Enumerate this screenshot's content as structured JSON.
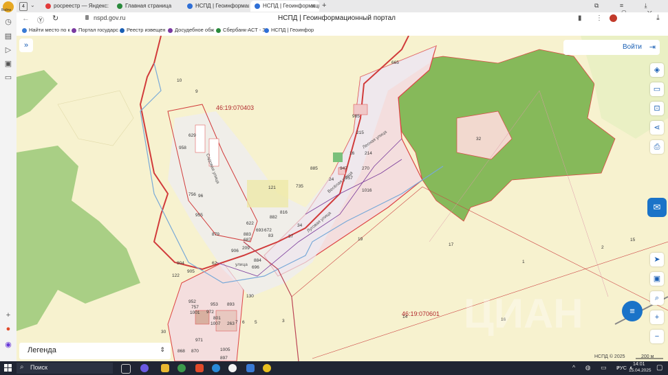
{
  "browser": {
    "user_label": "Войти",
    "tab_count": "4",
    "tabs": [
      {
        "title": "росреестр — Яндекс: нашл",
        "color": "#e23b3b"
      },
      {
        "title": "Главная страница",
        "color": "#2a8a3c"
      },
      {
        "title": "НСПД | Геоинформацион",
        "color": "#2f6fd6"
      },
      {
        "title": "НСПД | Геоинформацио",
        "color": "#2f6fd6"
      }
    ],
    "active_tab": 3,
    "url": "nspd.gov.ru",
    "page_title": "НСПД | Геоинформационный портал",
    "bookmarks": [
      {
        "label": "Найти место по к",
        "color": "#3a7bd5"
      },
      {
        "label": "Портал государс",
        "color": "#7a3aa0"
      },
      {
        "label": "Реестр извещен",
        "color": "#1a5fb4"
      },
      {
        "label": "Досудебное обж",
        "color": "#7a3aa0"
      },
      {
        "label": "Сбербанк-АСТ - З",
        "color": "#2a8a3c"
      },
      {
        "label": "НСПД | Геоинфор",
        "color": "#2f6fd6"
      }
    ]
  },
  "map": {
    "login_label": "Войти",
    "legend_label": "Легенда",
    "quarters": [
      "46:19:070403",
      "46:19:070601"
    ],
    "parcels": [
      "665",
      "10",
      "9",
      "629",
      "958",
      "985",
      "215",
      "214",
      "270",
      "947",
      "957",
      "24",
      "16",
      "885",
      "121",
      "735",
      "1016",
      "816",
      "882",
      "622",
      "883",
      "687",
      "693",
      "672",
      "83",
      "37",
      "34",
      "209",
      "906",
      "884",
      "696",
      "879",
      "756",
      "96",
      "955",
      "62",
      "904",
      "905",
      "122",
      "19",
      "17",
      "1",
      "2",
      "15",
      "16",
      "14",
      "32",
      "130",
      "953",
      "893",
      "952",
      "757",
      "1001",
      "972",
      "801",
      "1007",
      "263",
      "7",
      "6",
      "5",
      "3",
      "30",
      "971",
      "868",
      "870",
      "897",
      "1005"
    ],
    "streets": [
      "Садовая улица",
      "Лесная улица",
      "Весёлая улица",
      "Луговая улица",
      "улица"
    ],
    "scale_label": "200 м",
    "copyright": "НСПД © 2025",
    "watermark": "ЦИАН"
  },
  "taskbar": {
    "search_label": "Поиск",
    "lang": "РУС",
    "time": "14:01",
    "date": "15.04.2025"
  }
}
